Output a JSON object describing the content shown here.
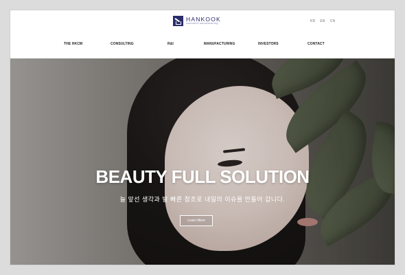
{
  "header": {
    "logo": {
      "name": "HANKOOK",
      "tagline": "cosmetics manufacturing"
    },
    "languages": [
      "KR",
      "EN",
      "CN"
    ],
    "nav": [
      "THE HKCM",
      "CONSULTING",
      "R&I",
      "MANUFACTURING",
      "INVESTORS",
      "CONTACT"
    ]
  },
  "hero": {
    "title": "BEAUTY FULL SOLUTION",
    "subtitle": "늘 앞선 생각과 발 빠른 창조로 내일의 이슈를 만들어 갑니다.",
    "button": "Learn More"
  },
  "colors": {
    "brand": "#2a2d6b",
    "background": "#dcdcdc"
  }
}
